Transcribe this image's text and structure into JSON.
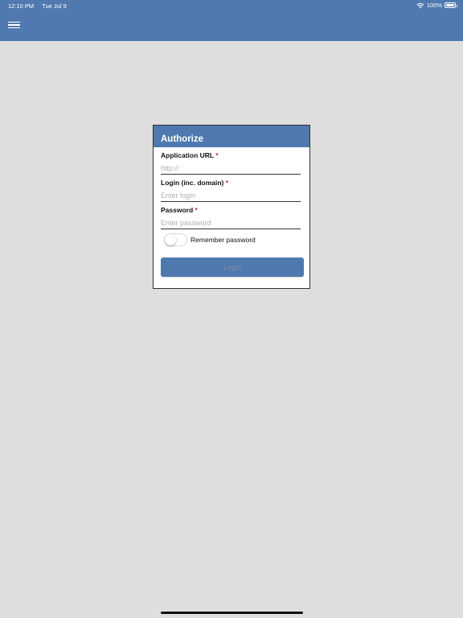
{
  "status_bar": {
    "time": "12:10 PM",
    "date": "Tue Jul 9",
    "battery": "100%"
  },
  "dialog": {
    "title": "Authorize",
    "fields": [
      {
        "label": "Application URL",
        "required_mark": "*",
        "placeholder": "http://",
        "value": ""
      },
      {
        "label": "Login (inc. domain)",
        "required_mark": "*",
        "placeholder": "Enter login",
        "value": ""
      },
      {
        "label": "Password",
        "required_mark": "*",
        "placeholder": "Enter password",
        "value": ""
      }
    ],
    "remember_label": "Remember password",
    "remember_on": false,
    "login_label": "Login"
  },
  "colors": {
    "header": "#4f79af",
    "background": "#dedede",
    "required": "#e02020"
  },
  "icons": [
    "menu-icon",
    "wifi-icon",
    "battery-icon"
  ]
}
